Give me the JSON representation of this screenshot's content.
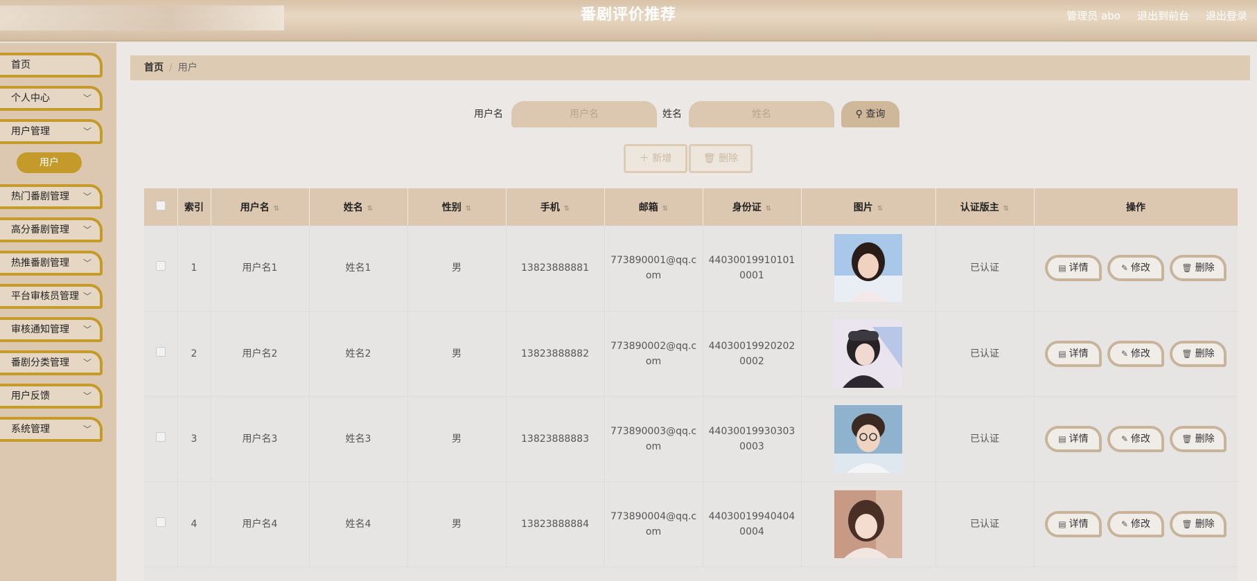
{
  "header": {
    "title": "番剧评价推荐",
    "admin": "管理员 abo",
    "to_front": "退出到前台",
    "logout": "退出登录"
  },
  "sidebar": {
    "items": [
      {
        "label": "首页",
        "chevron": false
      },
      {
        "label": "个人中心",
        "chevron": true
      },
      {
        "label": "用户管理",
        "chevron": true
      },
      {
        "label": "热门番剧管理",
        "chevron": true
      },
      {
        "label": "高分番剧管理",
        "chevron": true
      },
      {
        "label": "热推番剧管理",
        "chevron": true
      },
      {
        "label": "平台审核员管理",
        "chevron": true
      },
      {
        "label": "审核通知管理",
        "chevron": true
      },
      {
        "label": "番剧分类管理",
        "chevron": true
      },
      {
        "label": "用户反馈",
        "chevron": true
      },
      {
        "label": "系统管理",
        "chevron": true
      }
    ],
    "sub_item": "用户"
  },
  "breadcrumb": {
    "home": "首页",
    "sep": "/",
    "current": "用户"
  },
  "search": {
    "username_label": "用户名",
    "username_placeholder": "用户名",
    "name_label": "姓名",
    "name_placeholder": "姓名",
    "query_label": "查询"
  },
  "actions": {
    "add": "新增",
    "delete": "删除"
  },
  "table": {
    "headers": [
      "索引",
      "用户名",
      "姓名",
      "性别",
      "手机",
      "邮箱",
      "身份证",
      "图片",
      "认证版主",
      "操作"
    ],
    "rows": [
      {
        "index": "1",
        "username": "用户名1",
        "name": "姓名1",
        "gender": "男",
        "phone": "13823888881",
        "email": "773890001@qq.com",
        "idcard": "440300199101010001",
        "cert": "已认证"
      },
      {
        "index": "2",
        "username": "用户名2",
        "name": "姓名2",
        "gender": "男",
        "phone": "13823888882",
        "email": "773890002@qq.com",
        "idcard": "440300199202020002",
        "cert": "已认证"
      },
      {
        "index": "3",
        "username": "用户名3",
        "name": "姓名3",
        "gender": "男",
        "phone": "13823888883",
        "email": "773890003@qq.com",
        "idcard": "440300199303030003",
        "cert": "已认证"
      },
      {
        "index": "4",
        "username": "用户名4",
        "name": "姓名4",
        "gender": "男",
        "phone": "13823888884",
        "email": "773890004@qq.com",
        "idcard": "440300199404040004",
        "cert": "已认证"
      }
    ],
    "op_detail": "详情",
    "op_edit": "修改",
    "op_delete": "删除"
  },
  "colors": {
    "accent": "#c49a2a",
    "header_bg": "#dcc8b0",
    "sidebar_bg": "#dcc8b0"
  },
  "icons": {
    "search": "search-icon",
    "add": "plus-icon",
    "delete": "trash-icon",
    "detail": "document-icon",
    "edit": "pencil-icon",
    "sort": "sort-icon",
    "chevron": "chevron-down-icon"
  }
}
